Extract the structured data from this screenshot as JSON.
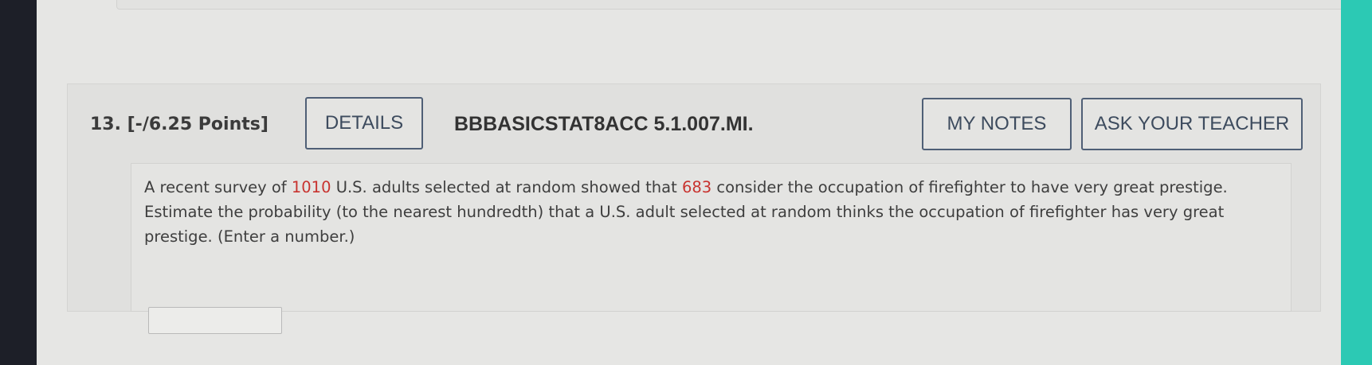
{
  "question": {
    "number_label": "13. [-/6.25 Points]",
    "details_button": "DETAILS",
    "code": "BBBASICSTAT8ACC 5.1.007.MI.",
    "my_notes_button": "MY NOTES",
    "ask_teacher_button": "ASK YOUR TEACHER",
    "text_part1": "A recent survey of ",
    "adults_count": "1010",
    "text_part2": " U.S. adults selected at random showed that ",
    "firefighter_count": "683",
    "text_part3": " consider the occupation of firefighter to have very great prestige. Estimate the probability (to the nearest hundredth) that a U.S. adult selected at random thinks the occupation of firefighter has very great prestige. (Enter a number.)",
    "answer_value": ""
  },
  "colors": {
    "highlight_number": "#c8332f",
    "button_border": "#4f5f76",
    "left_bezel": "#1d1f28",
    "right_bezel": "#2cc9b4"
  }
}
